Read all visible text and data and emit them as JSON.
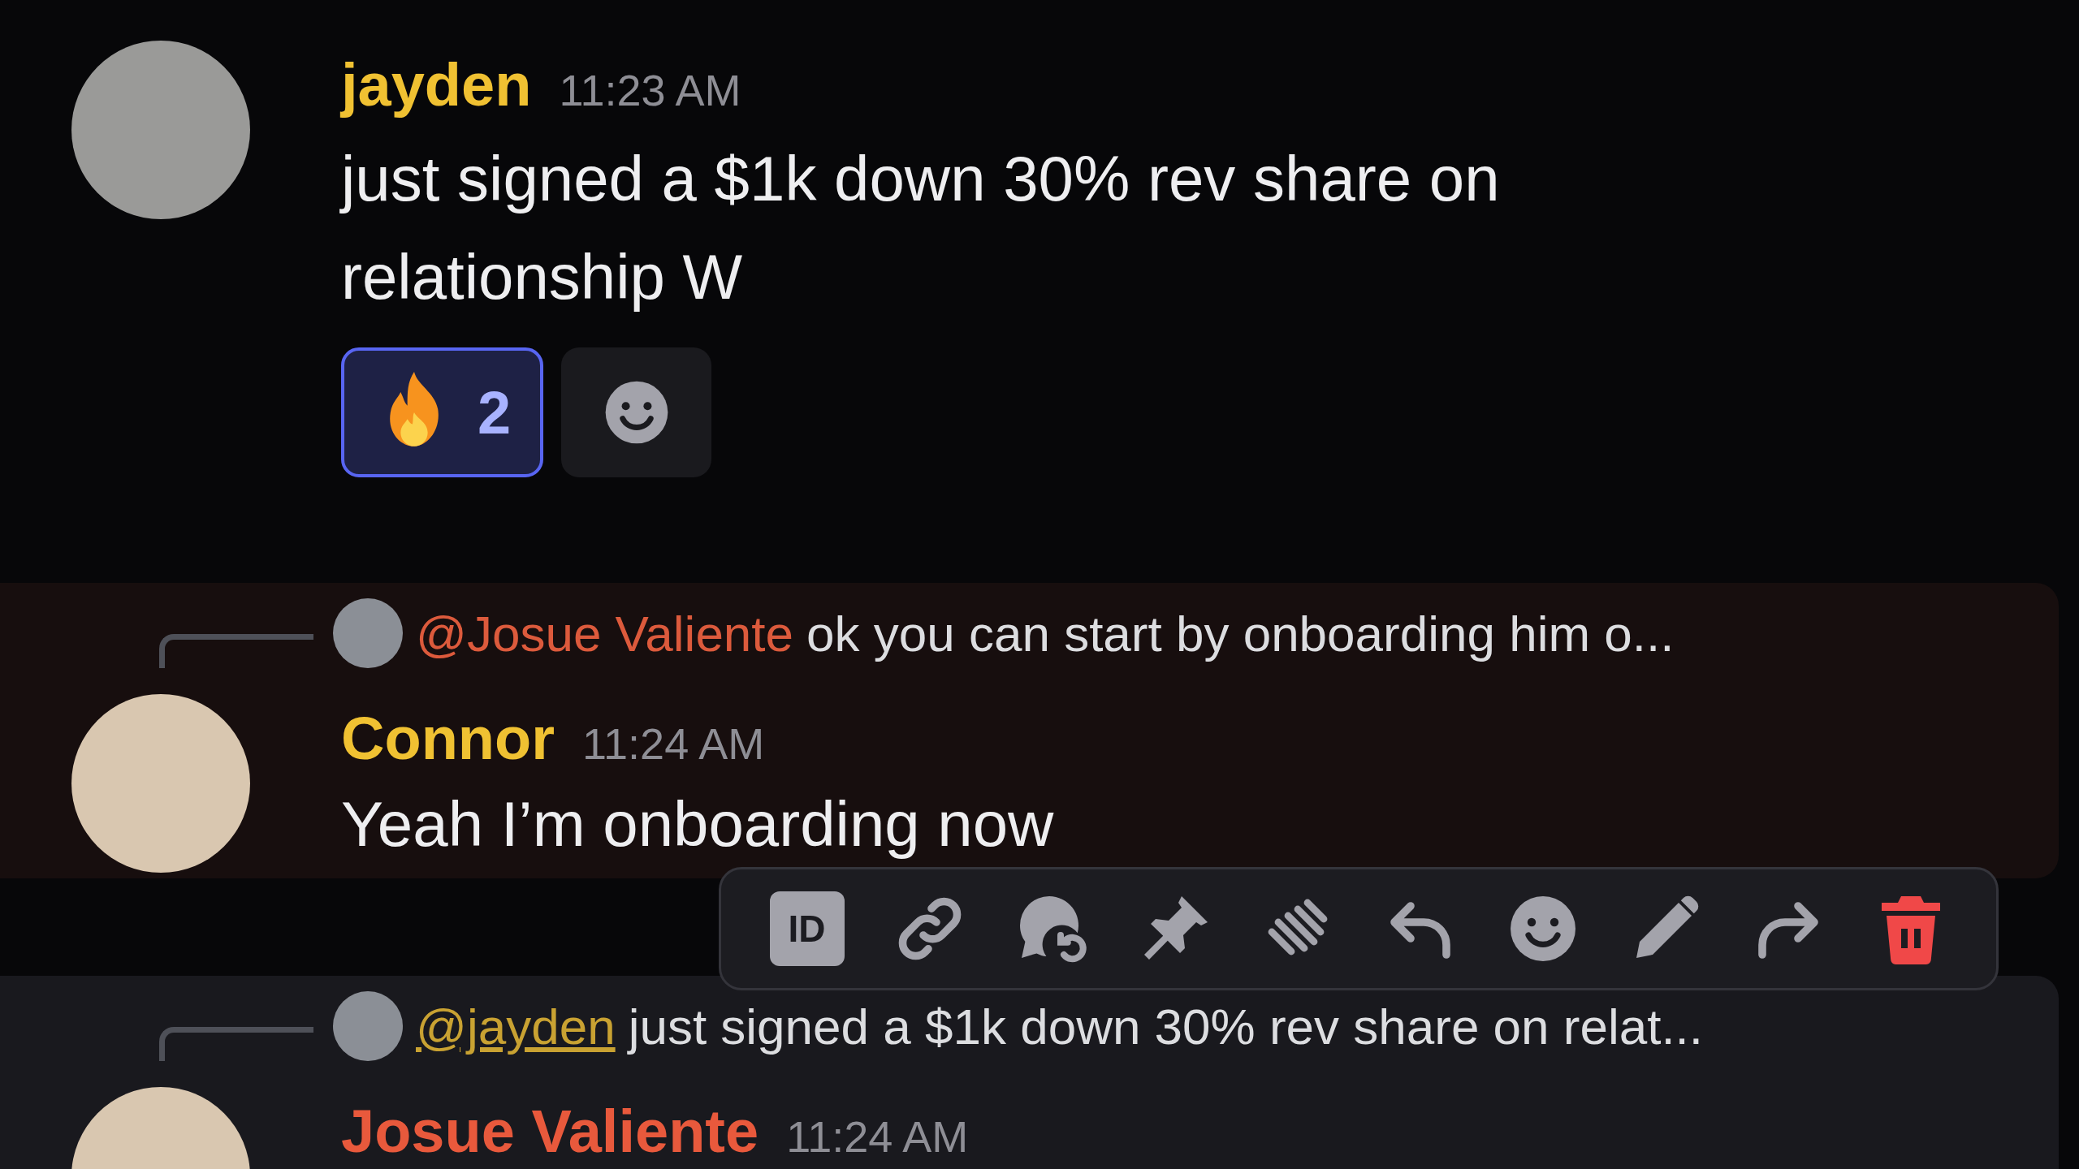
{
  "messages": [
    {
      "kind": "plain",
      "mentioned": false,
      "hovered": false,
      "author": "jayden",
      "color": "#f0c132",
      "time": "11:23 AM",
      "text": "just signed a $1k down 30% rev share on relationship W",
      "reactions": [
        {
          "kind": "fire",
          "count": "2",
          "selected": true
        }
      ]
    },
    {
      "kind": "reply",
      "mentioned": true,
      "hovered": false,
      "reply_to": {
        "mention": "@Josue Valiente",
        "color": "#dc5a3c",
        "underline": false,
        "text": "ok you can start by onboarding him o..."
      },
      "author": "Connor",
      "color": "#f0c132",
      "time": "11:24 AM",
      "text": "Yeah I’m onboarding now"
    },
    {
      "kind": "reply",
      "mentioned": false,
      "hovered": true,
      "reply_to": {
        "mention": "@jayden",
        "color": "#c9a232",
        "underline": true,
        "text": "just signed a $1k down 30% rev share on relat..."
      },
      "author": "Josue Valiente",
      "color": "#e8593c",
      "time": "11:24 AM"
    }
  ],
  "toolbar": {
    "buttons": [
      {
        "kind": "copy-id",
        "label": "ID"
      },
      {
        "kind": "link"
      },
      {
        "kind": "thread"
      },
      {
        "kind": "pin"
      },
      {
        "kind": "apps"
      },
      {
        "kind": "reply"
      },
      {
        "kind": "emoji"
      },
      {
        "kind": "edit"
      },
      {
        "kind": "forward"
      },
      {
        "kind": "delete"
      }
    ]
  }
}
